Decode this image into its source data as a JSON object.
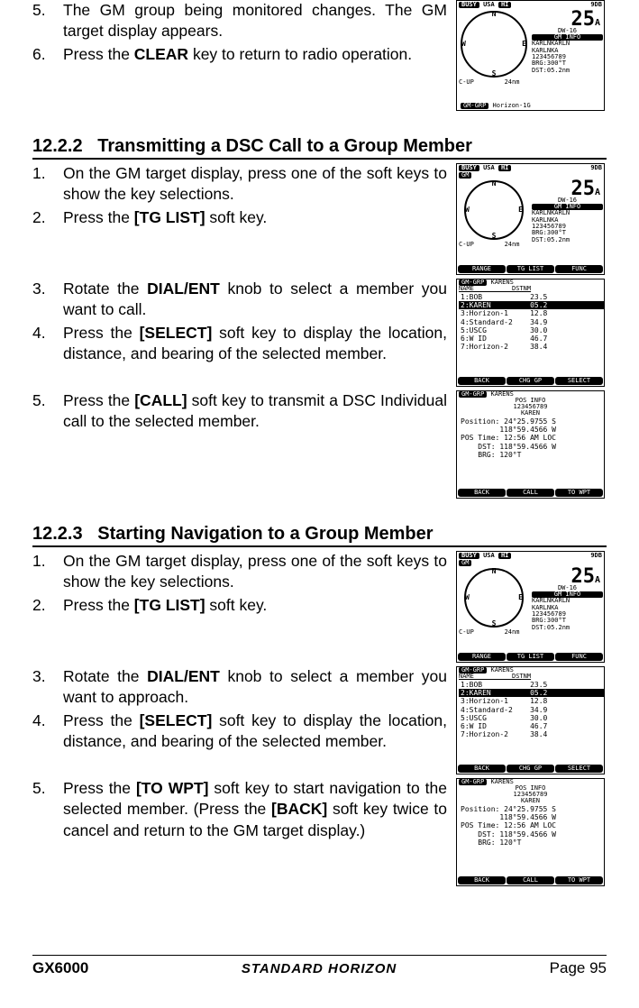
{
  "top_block": {
    "steps": [
      "The GM group being monitored changes. The GM target display appears.",
      "Press the <b>CLEAR</b> key to return to radio operation."
    ],
    "start": 4,
    "lcd": {
      "busy": "BUSY",
      "region": "USA",
      "hi": "HI",
      "sig": "9DB",
      "channel": "25",
      "sub": "A",
      "dw": "DW-16",
      "info_title": "GM INFO",
      "lines": [
        "KARLNKARLN",
        "KARLNKA",
        "123456789",
        "BRG:300°T",
        "DST:05.2nm"
      ],
      "bl": "C-UP        24nm",
      "footer": "GM-GRP Horizon-1G"
    }
  },
  "section1": {
    "number": "12.2.2",
    "title": "Transmitting a DSC Call to a Group Member",
    "block1": {
      "start": 0,
      "steps": [
        "On the GM target display, press one of the soft keys to show the key selections.",
        "Press the <b>[TG LIST]</b> soft key."
      ],
      "lcd": {
        "busy": "BUSY",
        "region": "USA",
        "hi": "HI",
        "sig": "9DB",
        "gm": "GM",
        "channel": "25",
        "sub": "A",
        "dw": "DW-16",
        "info_title": "GM INFO",
        "lines": [
          "KARLNKARLN",
          "KARLNKA",
          "123456789",
          "BRG:300°T",
          "DST:05.2nm"
        ],
        "bl": "C-UP        24nm",
        "btns": [
          "RANGE",
          "TG LIST",
          "FUNC"
        ]
      }
    },
    "block2": {
      "start": 2,
      "steps": [
        "Rotate the <b>DIAL/ENT</b> knob to select a member you want to call.",
        "Press the <b>[SELECT]</b> soft key to display the location, distance, and bearing of the selected member."
      ],
      "lcd": {
        "header": "GM-GRP KARENS",
        "cols": "NAME          DSTNM",
        "rows": [
          "1:BOB           23.5",
          "2:KAREN         05.2",
          "3:Horizon-1     12.8",
          "4:Standard-2    34.9",
          "5:USCG          30.0",
          "6:W ID          46.7",
          "7:Horizon-2     38.4"
        ],
        "selected_index": 1,
        "btns": [
          "BACK",
          "CHG GP",
          "SELECT"
        ]
      }
    },
    "block3": {
      "start": 4,
      "steps": [
        "Press the <b>[CALL]</b> soft key to transmit a DSC Individual call to the selected member."
      ],
      "lcd": {
        "header": "GM-GRP KARENS",
        "title": "POS INFO",
        "id": "123456789",
        "name": "KAREN",
        "rows": [
          "Position: 24°25.9755 S",
          "         118°59.4566 W",
          "POS Time: 12:56 AM LOC",
          "    DST: 118°59.4566 W",
          "    BRG: 120°T"
        ],
        "btns": [
          "BACK",
          "CALL",
          "TO WPT"
        ]
      }
    }
  },
  "section2": {
    "number": "12.2.3",
    "title": "Starting Navigation to a Group Member",
    "block1": {
      "start": 0,
      "steps": [
        "On the GM target display, press one of the soft keys to show the key selections.",
        "Press the <b>[TG LIST]</b> soft key."
      ],
      "lcd": {
        "busy": "BUSY",
        "region": "USA",
        "hi": "HI",
        "sig": "9DB",
        "gm": "GM",
        "channel": "25",
        "sub": "A",
        "dw": "DW-16",
        "info_title": "GM INFO",
        "lines": [
          "KARLNKARLN",
          "KARLNKA",
          "123456789",
          "BRG:300°T",
          "DST:05.2nm"
        ],
        "bl": "C-UP        24nm",
        "btns": [
          "RANGE",
          "TG LIST",
          "FUNC"
        ]
      }
    },
    "block2": {
      "start": 2,
      "steps": [
        "Rotate the <b>DIAL/ENT</b> knob to select a member you want to approach.",
        "Press the <b>[SELECT]</b> soft key to display the location, distance, and bearing of the selected member."
      ],
      "lcd": {
        "header": "GM-GRP KARENS",
        "cols": "NAME          DSTNM",
        "rows": [
          "1:BOB           23.5",
          "2:KAREN         05.2",
          "3:Horizon-1     12.8",
          "4:Standard-2    34.9",
          "5:USCG          30.0",
          "6:W ID          46.7",
          "7:Horizon-2     38.4"
        ],
        "selected_index": 1,
        "btns": [
          "BACK",
          "CHG GP",
          "SELECT"
        ]
      }
    },
    "block3": {
      "start": 4,
      "steps": [
        "Press the <b>[TO WPT]</b> soft key to start navigation to the selected member. (Press the <b>[BACK]</b> soft key twice to cancel and return to the GM target display.)"
      ],
      "lcd": {
        "header": "GM-GRP KARENS",
        "title": "POS INFO",
        "id": "123456789",
        "name": "KAREN",
        "rows": [
          "Position: 24°25.9755 S",
          "         118°59.4566 W",
          "POS Time: 12:56 AM LOC",
          "    DST: 118°59.4566 W",
          "    BRG: 120°T"
        ],
        "btns": [
          "BACK",
          "CALL",
          "TO WPT"
        ]
      }
    }
  },
  "footer": {
    "model": "GX6000",
    "brand": "STANDARD HORIZON",
    "page": "Page 95"
  }
}
